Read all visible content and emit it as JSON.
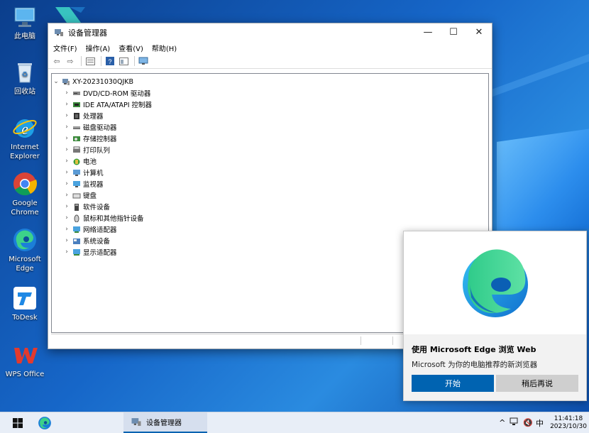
{
  "desktop": {
    "icons": [
      {
        "label": "此电脑",
        "icon": "computer-icon"
      },
      {
        "label": "回收站",
        "icon": "recycle-bin-icon"
      },
      {
        "label": "Internet Explorer",
        "icon": "ie-icon"
      },
      {
        "label": "Google Chrome",
        "icon": "chrome-icon"
      },
      {
        "label": "Microsoft Edge",
        "icon": "edge-icon"
      },
      {
        "label": "ToDesk",
        "icon": "todesk-icon"
      },
      {
        "label": "WPS Office",
        "icon": "wps-icon"
      }
    ]
  },
  "window": {
    "title": "设备管理器",
    "menu": [
      "文件(F)",
      "操作(A)",
      "查看(V)",
      "帮助(H)"
    ],
    "toolbar": [
      "back-arrow-icon",
      "forward-arrow-icon",
      "properties-icon",
      "help-icon",
      "view-icon",
      "monitor-icon"
    ],
    "tree": {
      "root": "XY-20231030QJKB",
      "items": [
        {
          "label": "DVD/CD-ROM 驱动器",
          "icon": "dvd-drive-icon"
        },
        {
          "label": "IDE ATA/ATAPI 控制器",
          "icon": "ide-controller-icon"
        },
        {
          "label": "处理器",
          "icon": "processor-icon"
        },
        {
          "label": "磁盘驱动器",
          "icon": "disk-drive-icon"
        },
        {
          "label": "存储控制器",
          "icon": "storage-controller-icon"
        },
        {
          "label": "打印队列",
          "icon": "printer-icon"
        },
        {
          "label": "电池",
          "icon": "battery-icon"
        },
        {
          "label": "计算机",
          "icon": "computer-icon"
        },
        {
          "label": "监视器",
          "icon": "monitor-icon"
        },
        {
          "label": "键盘",
          "icon": "keyboard-icon"
        },
        {
          "label": "软件设备",
          "icon": "software-device-icon"
        },
        {
          "label": "鼠标和其他指针设备",
          "icon": "mouse-icon"
        },
        {
          "label": "网络适配器",
          "icon": "network-adapter-icon"
        },
        {
          "label": "系统设备",
          "icon": "system-device-icon"
        },
        {
          "label": "显示适配器",
          "icon": "display-adapter-icon"
        }
      ]
    }
  },
  "toast": {
    "title": "使用 Microsoft Edge 浏览 Web",
    "body": "Microsoft 为你的电脑推荐的新浏览器",
    "primary": "开始",
    "secondary": "稍后再说"
  },
  "taskbar": {
    "active_app": "设备管理器",
    "ime": "中",
    "time": "11:41:18",
    "date": "2023/10/30"
  },
  "colors": {
    "accent": "#0063b1",
    "desktop": "#1666c8"
  }
}
